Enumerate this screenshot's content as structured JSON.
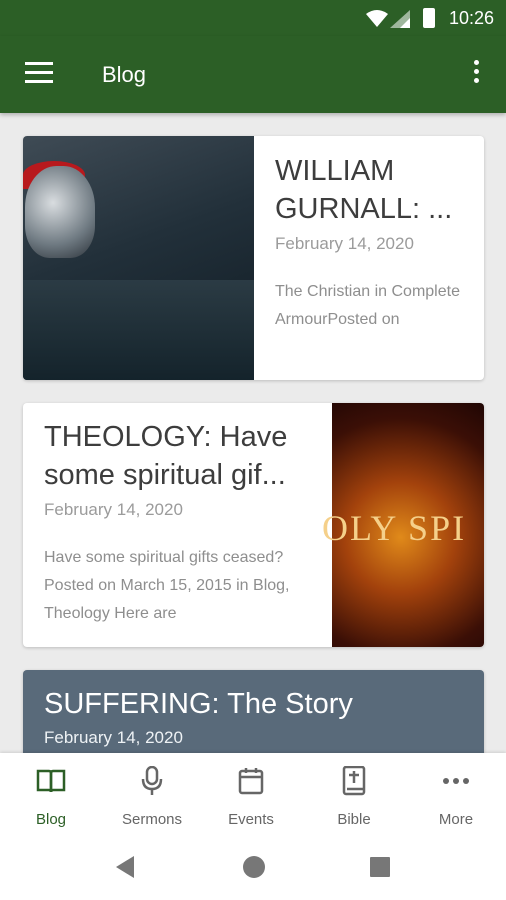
{
  "status": {
    "time": "10:26"
  },
  "app_bar": {
    "title": "Blog"
  },
  "posts": [
    {
      "title": "WILLIAM GURNALL: ...",
      "date": "February 14, 2020",
      "excerpt": "The Christian in Complete ArmourPosted on"
    },
    {
      "title": "THEOLOGY: Have some spiritual gif...",
      "date": "February 14, 2020",
      "excerpt": "Have some spiritual gifts ceased?Posted on March 15, 2015  in Blog, Theology Here are",
      "image_text": "OLY SPI"
    },
    {
      "title": "SUFFERING: The Story",
      "date": "February 14, 2020"
    }
  ],
  "bottom_nav": [
    {
      "label": "Blog",
      "icon": "book-icon",
      "active": true
    },
    {
      "label": "Sermons",
      "icon": "microphone-icon"
    },
    {
      "label": "Events",
      "icon": "calendar-icon"
    },
    {
      "label": "Bible",
      "icon": "bible-icon"
    },
    {
      "label": "More",
      "icon": "more-dots-icon"
    }
  ],
  "colors": {
    "primary": "#2c5f26",
    "accent_active": "#2c5f26"
  }
}
